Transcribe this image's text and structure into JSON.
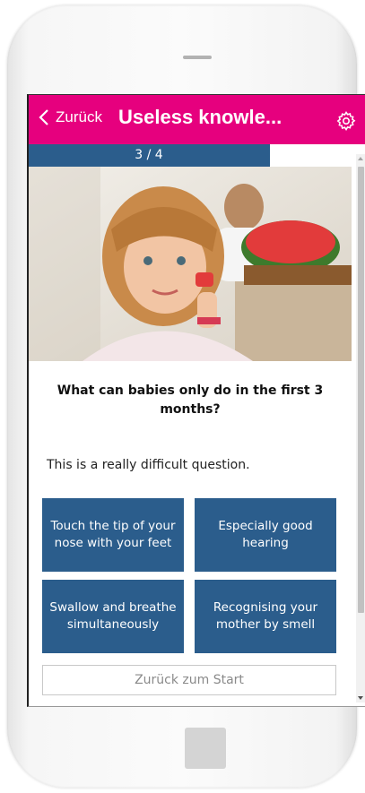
{
  "header": {
    "back_label": "Zurück",
    "title": "Useless knowle...",
    "accent_color": "#e6007e"
  },
  "progress": {
    "text": "3 / 4",
    "fraction": 0.75,
    "color": "#2b5d8c"
  },
  "question": {
    "text": "What can babies only do in the first 3 months?",
    "description": "This is a really difficult question."
  },
  "answers": [
    "Touch the tip of your nose with your feet",
    "Especially good hearing",
    "Swallow and breathe simultaneously",
    "Recognising your mother by smell"
  ],
  "footer": {
    "restart_label": "Zurück zum Start"
  },
  "icons": {
    "back": "chevron-left-icon",
    "settings": "gear-icon"
  }
}
